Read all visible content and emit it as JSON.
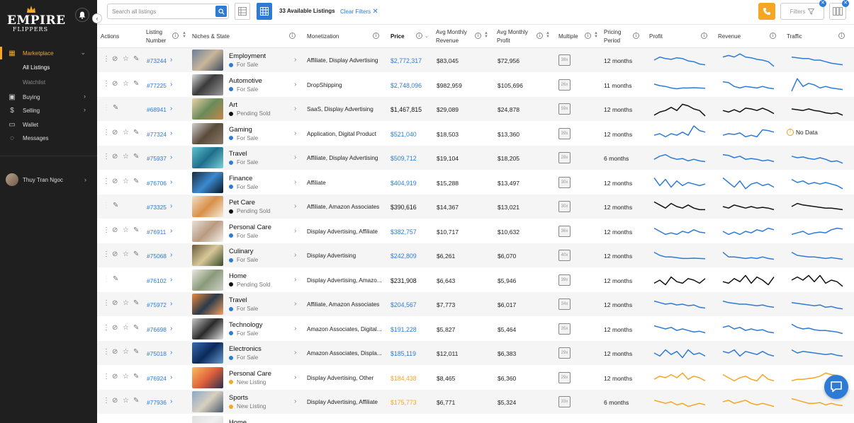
{
  "sidebar": {
    "brand_line1": "EMPIRE",
    "brand_line2": "FLIPPERS",
    "items": [
      {
        "label": "Marketplace",
        "icon": "grid-icon",
        "active": true
      },
      {
        "label": "All Listings",
        "sub": true
      },
      {
        "label": "Watchlist",
        "sub": true
      },
      {
        "label": "Buying",
        "icon": "bag-icon"
      },
      {
        "label": "Selling",
        "icon": "dollar-icon"
      },
      {
        "label": "Wallet",
        "icon": "wallet-icon"
      },
      {
        "label": "Messages",
        "icon": "chat-icon"
      }
    ],
    "user_name": "Thuy Tran Ngoc"
  },
  "topbar": {
    "search_placeholder": "Search all listings",
    "available": "33 Available Listings",
    "clear_filters": "Clear Filters",
    "filters_label": "Filters"
  },
  "table": {
    "headers": {
      "actions": "Actions",
      "listing": "Listing Number",
      "niche": "Niches & State",
      "monetization": "Monetization",
      "price": "Price",
      "revenue": "Avg Monthly Revenue",
      "profit": "Avg Monthly Profit",
      "multiple": "Multiple",
      "period": "Pricing Period",
      "profit_chart": "Profit",
      "revenue_chart": "Revenue",
      "traffic": "Traffic"
    },
    "no_data": "No Data",
    "rows": [
      {
        "id": "#73244",
        "niche": "Employment",
        "status": "For Sale",
        "mono": "Affiliate, Display Advertising",
        "price": "$2,772,317",
        "rev": "$83,045",
        "profit": "$72,956",
        "mult": "38x",
        "period": "12 months"
      },
      {
        "id": "#77225",
        "niche": "Automotive",
        "status": "For Sale",
        "mono": "DropShipping",
        "price": "$2,748,096",
        "rev": "$982,959",
        "profit": "$105,696",
        "mult": "26x",
        "period": "11 months"
      },
      {
        "id": "#68941",
        "niche": "Art",
        "status": "Pending Sold",
        "mono": "SaaS, Display Advertising",
        "price": "$1,467,815",
        "rev": "$29,089",
        "profit": "$24,878",
        "mult": "59x",
        "period": "12 months"
      },
      {
        "id": "#77324",
        "niche": "Gaming",
        "status": "For Sale",
        "mono": "Application, Digital Product",
        "price": "$521,040",
        "rev": "$18,503",
        "profit": "$13,360",
        "mult": "39x",
        "period": "12 months"
      },
      {
        "id": "#75937",
        "niche": "Travel",
        "status": "For Sale",
        "mono": "Affiliate, Display Advertising",
        "price": "$509,712",
        "rev": "$19,104",
        "profit": "$18,205",
        "mult": "28x",
        "period": "6 months"
      },
      {
        "id": "#76706",
        "niche": "Finance",
        "status": "For Sale",
        "mono": "Affiliate",
        "price": "$404,919",
        "rev": "$15,288",
        "profit": "$13,497",
        "mult": "30x",
        "period": "12 months"
      },
      {
        "id": "#73325",
        "niche": "Pet Care",
        "status": "Pending Sold",
        "mono": "Affiliate, Amazon Associates",
        "price": "$390,616",
        "rev": "$14,367",
        "profit": "$13,021",
        "mult": "30x",
        "period": "12 months"
      },
      {
        "id": "#76911",
        "niche": "Personal Care",
        "status": "For Sale",
        "mono": "Display Advertising, Affiliate",
        "price": "$382,757",
        "rev": "$10,717",
        "profit": "$10,632",
        "mult": "36x",
        "period": "12 months"
      },
      {
        "id": "#75068",
        "niche": "Culinary",
        "status": "For Sale",
        "mono": "Display Advertising",
        "price": "$242,809",
        "rev": "$6,261",
        "profit": "$6,070",
        "mult": "40x",
        "period": "12 months"
      },
      {
        "id": "#76102",
        "niche": "Home",
        "status": "Pending Sold",
        "mono": "Display Advertising, Amazo...",
        "price": "$231,908",
        "rev": "$6,643",
        "profit": "$5,946",
        "mult": "39x",
        "period": "12 months"
      },
      {
        "id": "#75972",
        "niche": "Travel",
        "status": "For Sale",
        "mono": "Affiliate, Amazon Associates",
        "price": "$204,567",
        "rev": "$7,773",
        "profit": "$6,017",
        "mult": "34x",
        "period": "12 months"
      },
      {
        "id": "#76698",
        "niche": "Technology",
        "status": "For Sale",
        "mono": "Amazon Associates, Digital...",
        "price": "$191,228",
        "rev": "$5,827",
        "profit": "$5,464",
        "mult": "35x",
        "period": "12 months"
      },
      {
        "id": "#75018",
        "niche": "Electronics",
        "status": "For Sale",
        "mono": "Amazon Associates, Displa...",
        "price": "$185,119",
        "rev": "$12,011",
        "profit": "$6,383",
        "mult": "29x",
        "period": "12 months"
      },
      {
        "id": "#76924",
        "niche": "Personal Care",
        "status": "New Listing",
        "mono": "Display Advertising, Other",
        "price": "$184,438",
        "rev": "$8,465",
        "profit": "$6,360",
        "mult": "29x",
        "period": "12 months"
      },
      {
        "id": "#77936",
        "niche": "Sports",
        "status": "New Listing",
        "mono": "Display Advertising, Affiliate",
        "price": "$175,773",
        "rev": "$6,771",
        "profit": "$5,324",
        "mult": "33x",
        "period": "6 months"
      },
      {
        "id": "",
        "niche": "Home",
        "status": "",
        "mono": "",
        "price": "",
        "rev": "",
        "profit": "",
        "mult": "",
        "period": ""
      }
    ]
  },
  "colors": {
    "accent": "#2e7bd6",
    "orange": "#f5a623",
    "pending": "#111111",
    "sidebar_bg": "#1f1f1f"
  }
}
